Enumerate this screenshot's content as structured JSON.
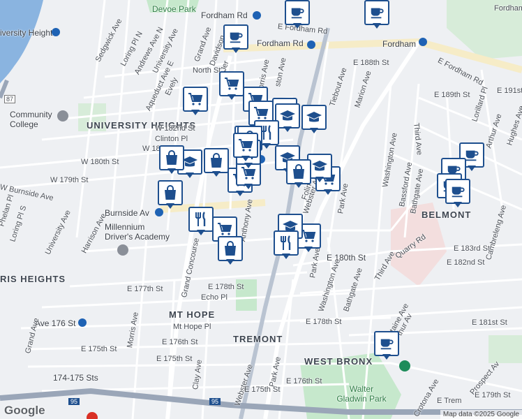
{
  "map": {
    "attribution": "Map data ©2025 Google",
    "logo": "Google",
    "colors": {
      "marker": "#1e4f8e",
      "water": "#8ab4e0",
      "park": "#c6e8cc",
      "road": "#ffffff",
      "highway": "#9aa6b8"
    }
  },
  "labels": {
    "devoe_park": "Devoe Park",
    "fordham_rd_w": "Fordham Rd",
    "fordham_rd_e": "E Fordham Rd",
    "fordham_rd2": "Fordham Rd",
    "fordham": "Fordham",
    "e_fordham_rd_right": "E Fordham Rd",
    "fordham_univ": "Fordham Univers",
    "university_heights": "UNIVERSITY HEIGHTS",
    "univ_heights_top": "iversity Heights",
    "community_college": "Community College",
    "sedgwick": "Sedgwick Ave",
    "loring": "Loring Pl N",
    "andrews": "Andrews Ave N",
    "university_ave_top": "University Ave",
    "grand_ave": "Grand Ave",
    "davidson": "Davidson",
    "jerome": "Jer",
    "morris": "Morris Ave",
    "kingston": "ston Ave",
    "north_st": "North St",
    "aqueduct": "Aqueduct Ave E",
    "evelyn": "Evely",
    "w182": "W 182nd St",
    "clinton": "Clinton Pl",
    "w181": "W 181st",
    "w180": "W 180th St",
    "w179": "W 179th St",
    "burnside": "W Burnside Ave",
    "burnside_av": "Burnside Av",
    "university_ave": "University Ave",
    "harrison": "Harrison Ave",
    "millennium": "Millennium",
    "drivers": "Driver's Academy",
    "morris_heights": "RIS HEIGHTS",
    "phelan": "Phelan Pl",
    "loring2": "Loring Pl S",
    "grand_concourse": "Grand Concourse",
    "anthony": "Anthony Ave",
    "e177": "E 177th St",
    "e178": "E 178th St",
    "echo": "Echo Pl",
    "mt_hope": "MT HOPE",
    "mt_hope_pl": "Mt Hope Pl",
    "e176": "E 176th St",
    "e175": "E 175th St",
    "e175b": "E 175th St",
    "clay": "Clay Ave",
    "st176": "Ave 176 St",
    "grand_ave2": "Grand Ave",
    "morris2": "Morris Ave",
    "st174": "174-175 Sts",
    "tremont": "TREMONT",
    "webster_ave": "Webster Ave",
    "webster_ave2": "Webster Ave",
    "park_ave": "Park Ave",
    "park_ave2": "Park Ave",
    "park_ave3": "Park Ave",
    "e180": "E 180th St",
    "e178b": "E 178th St",
    "e176b": "E 176th St",
    "e175c": "E 175th St",
    "washington": "Washington Ave",
    "washington2": "Washington Ave",
    "bathgate": "Bathgate Ave",
    "bathgate2": "Bathgate Ave",
    "bassford": "Bassford Ave",
    "third_ave": "Third Ave",
    "third_ave2": "Third Ave",
    "quarry": "Quarry Rd",
    "e182": "E 182nd St",
    "e183": "E 183rd St",
    "e181": "E 181st St",
    "e179": "E 179th St",
    "e188": "E 188th St",
    "e189": "E 189th St",
    "e191": "E 191st",
    "tiebout": "Tiebout Ave",
    "marion": "Marion Ave",
    "belmont": "BELMONT",
    "west_bronx": "WEST BRONX",
    "walter_gladwin": "Walter Gladwin Park",
    "crotona": "Crotona Ave",
    "e_tremont": "E Trem",
    "prospect": "Prospect Av",
    "fontaine": "ontaine Ave",
    "arthur": "Arthur Ave",
    "arthur2": "thur Av",
    "lorillard": "Lorillard Pl",
    "hughes": "Hughes Ave",
    "cambreleng": "Cambreleng Ave",
    "folin": "Folin",
    "i87": "87",
    "i95": "95",
    "i95b": "95"
  },
  "markers": [
    {
      "type": "cafe-icon"
    },
    {
      "type": "cafe-icon"
    },
    {
      "type": "cafe-icon"
    },
    {
      "type": "cart-icon"
    },
    {
      "type": "cart-icon"
    },
    {
      "type": "cart-icon"
    },
    {
      "type": "cart-icon"
    },
    {
      "type": "cart-icon"
    },
    {
      "type": "cart-icon"
    },
    {
      "type": "cart-icon"
    },
    {
      "type": "cart-icon"
    },
    {
      "type": "cart-icon"
    },
    {
      "type": "school-icon"
    },
    {
      "type": "school-icon"
    },
    {
      "type": "school-icon"
    },
    {
      "type": "school-icon"
    },
    {
      "type": "school-icon"
    },
    {
      "type": "school-icon"
    },
    {
      "type": "restaurant-icon"
    },
    {
      "type": "restaurant-icon"
    },
    {
      "type": "restaurant-icon"
    },
    {
      "type": "restaurant-icon"
    },
    {
      "type": "shopping-bag-icon"
    },
    {
      "type": "shopping-bag-icon"
    },
    {
      "type": "shopping-bag-icon"
    },
    {
      "type": "shopping-bag-icon"
    },
    {
      "type": "shopping-bag-icon"
    },
    {
      "type": "shopping-bag-icon"
    },
    {
      "type": "cafe-icon"
    },
    {
      "type": "cafe-icon"
    },
    {
      "type": "cafe-icon"
    },
    {
      "type": "cafe-icon"
    },
    {
      "type": "cafe-icon"
    },
    {
      "type": "cart-icon"
    },
    {
      "type": "restaurant-icon"
    },
    {
      "type": "cart-icon"
    }
  ]
}
